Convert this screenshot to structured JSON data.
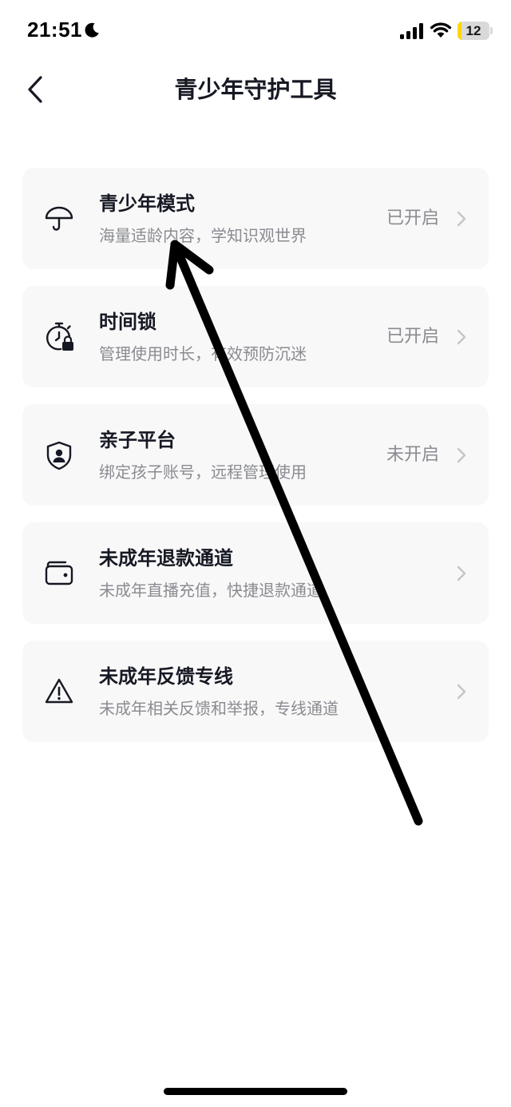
{
  "status_bar": {
    "time": "21:51",
    "battery_level": "12",
    "battery_fraction": 0.12,
    "icons": [
      "moon-icon",
      "cellular-signal-icon",
      "wifi-icon",
      "battery-icon"
    ]
  },
  "header": {
    "title": "青少年守护工具",
    "back_icon": "chevron-left-icon"
  },
  "cards": [
    {
      "icon": "umbrella-icon",
      "title": "青少年模式",
      "subtitle": "海量适龄内容，学知识观世界",
      "status": "已开启"
    },
    {
      "icon": "timer-lock-icon",
      "title": "时间锁",
      "subtitle": "管理使用时长，有效预防沉迷",
      "status": "已开启"
    },
    {
      "icon": "shield-user-icon",
      "title": "亲子平台",
      "subtitle": "绑定孩子账号，远程管理使用",
      "status": "未开启"
    },
    {
      "icon": "wallet-icon",
      "title": "未成年退款通道",
      "subtitle": "未成年直播充值，快捷退款通道",
      "status": ""
    },
    {
      "icon": "warning-triangle-icon",
      "title": "未成年反馈专线",
      "subtitle": "未成年相关反馈和举报，专线通道",
      "status": ""
    }
  ],
  "colors": {
    "title_text": "#161823",
    "secondary_text": "#8a8b91",
    "card_background": "#f8f8f8",
    "chevron": "#c4c5c8",
    "annotation_arrow": "#000000",
    "battery_fill": "#ffd60a"
  }
}
